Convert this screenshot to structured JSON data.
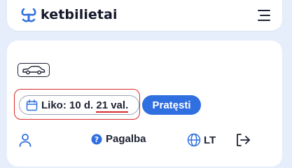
{
  "brand": {
    "name": "ketbilietai",
    "logo_icon": "ketbilietai-logo-icon",
    "accent_color": "#2f6fe0"
  },
  "header": {
    "menu_icon": "hamburger-menu-icon"
  },
  "vehicle": {
    "icon": "car-icon"
  },
  "timer": {
    "icon": "calendar-icon",
    "label_prefix": "Liko: 10 d.",
    "label_hours": "21 val.",
    "highlight_color": "#d92b2b"
  },
  "actions": {
    "extend_label": "Pratęsti"
  },
  "nav": {
    "user_icon": "user-icon",
    "help_icon": "help-icon",
    "help_label": "Pagalba",
    "language_icon": "globe-icon",
    "language_label": "LT",
    "logout_icon": "logout-icon"
  }
}
